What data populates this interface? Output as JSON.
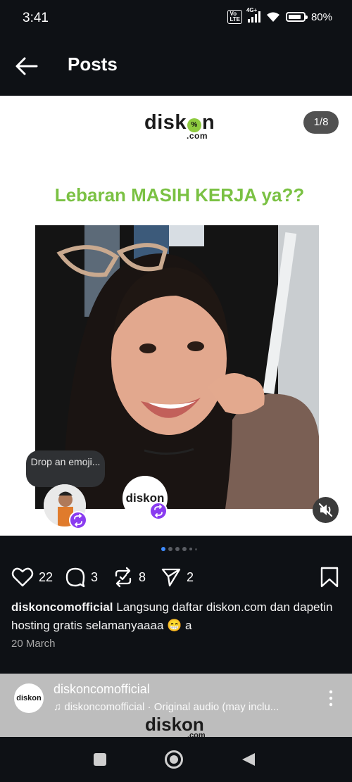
{
  "status": {
    "time": "3:41",
    "network": "4G+",
    "battery": "80%"
  },
  "header": {
    "title": "Posts"
  },
  "post": {
    "counter": "1/8",
    "brand_logo": "diskon",
    "brand_logo_suffix": ".com",
    "headline": "Lebaran MASIH KERJA ya??",
    "drop_emoji": "Drop an emoji...",
    "avatar_brand": "diskon",
    "likes": "22",
    "comments": "3",
    "reposts": "8",
    "shares": "2",
    "username": "diskoncomofficial",
    "caption": "Langsung daftar diskon.com dan dapetin hosting gratis selamanyaaaa 😁 a",
    "date": "20 March"
  },
  "mini_player": {
    "username": "diskoncomofficial",
    "audio": "diskoncomofficial · Original audio (may inclu...",
    "avatar": "diskon",
    "logo": "diskon",
    "logo_suffix": ".com"
  },
  "colors": {
    "accent_green": "#7ac143",
    "badge_purple": "#8a3cf0",
    "dot_active": "#3f8cff"
  }
}
